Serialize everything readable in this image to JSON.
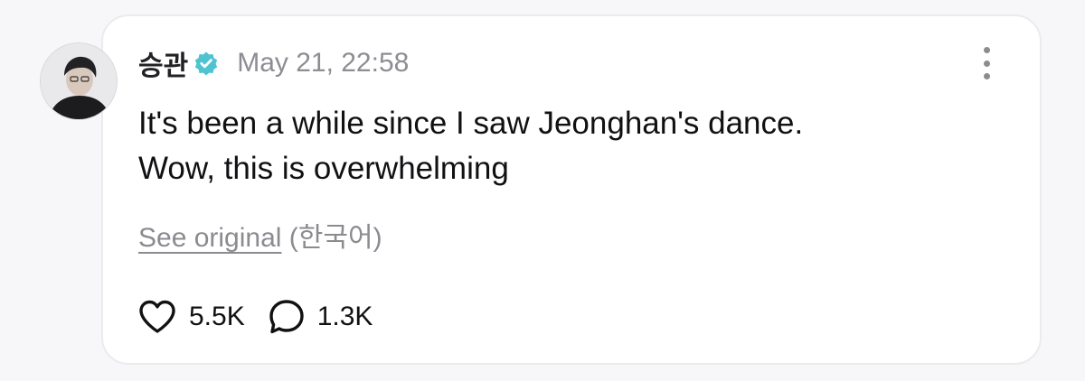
{
  "post": {
    "author": {
      "name": "승관",
      "verified": true,
      "avatar": "profile-photo"
    },
    "timestamp": "May 21, 22:58",
    "text_lines": [
      "It's been a while since I saw Jeonghan's dance.",
      "Wow, this is overwhelming"
    ],
    "translation": {
      "link_label": "See original",
      "language": "(한국어)"
    },
    "stats": {
      "likes": "5.5K",
      "comments": "1.3K"
    }
  },
  "icons": {
    "verified": "verified-badge-icon",
    "more": "more-vertical-icon",
    "like": "heart-icon",
    "comment": "comment-bubble-icon"
  },
  "colors": {
    "verified_badge": "#4fc3d0",
    "timestamp": "#8d8d93",
    "text": "#111114",
    "card_border": "#ebebee"
  }
}
